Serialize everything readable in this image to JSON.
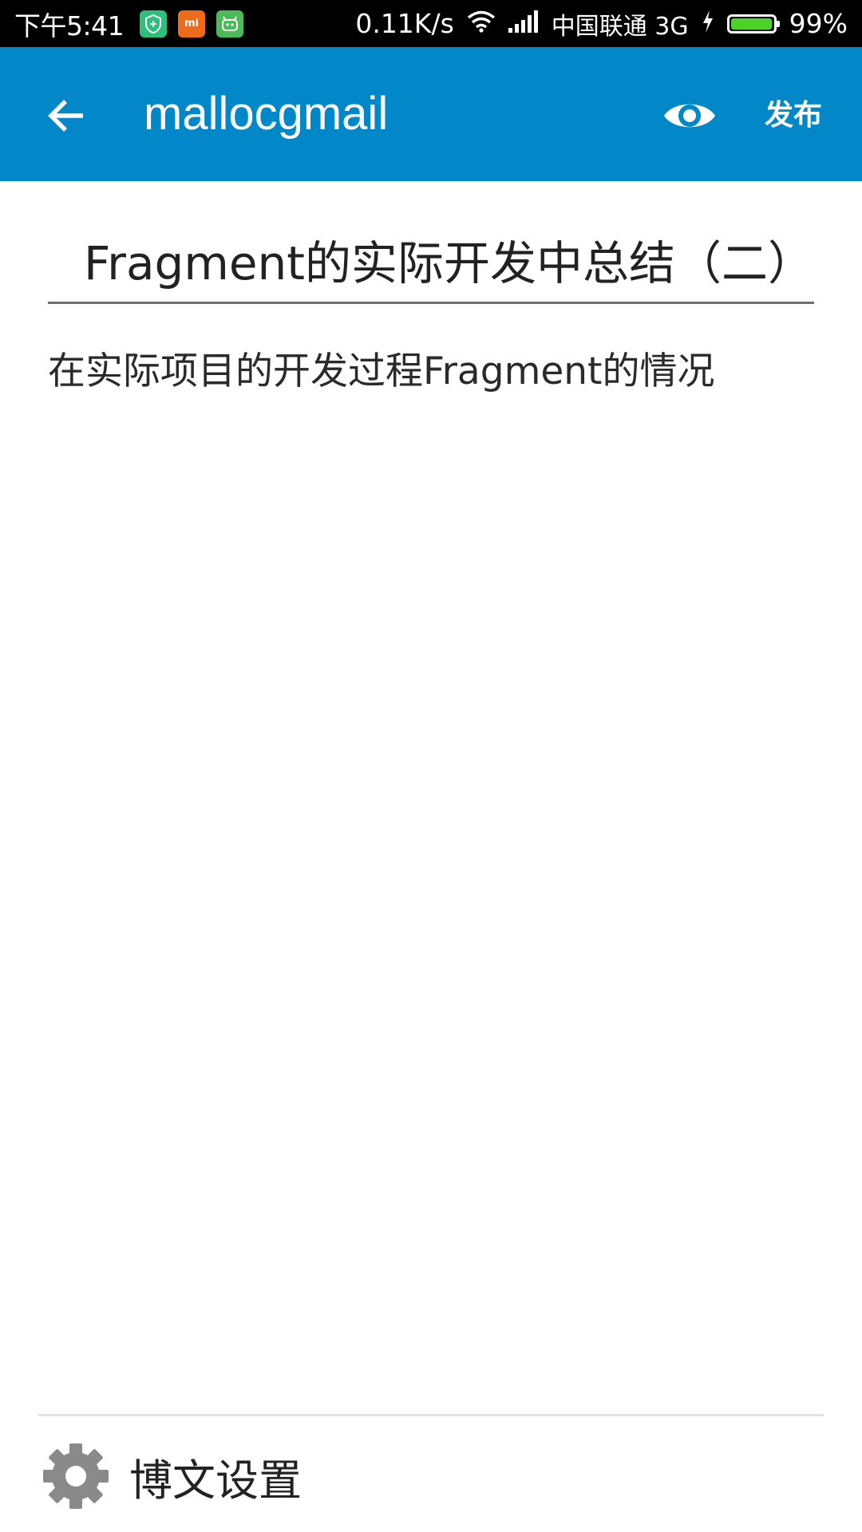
{
  "status_bar": {
    "time": "下午5:41",
    "notif_icons": [
      {
        "name": "shield-app-icon",
        "color": "#2dbf7b"
      },
      {
        "name": "mi-app-icon",
        "color": "#ef6b1c",
        "glyph": "mi"
      },
      {
        "name": "android-app-icon",
        "color": "#4aba5a"
      }
    ],
    "net_speed": "0.11K/s",
    "carrier": "中国联通 3G",
    "battery": "99%",
    "battery_level": 0.99,
    "battery_color": "#4cd327"
  },
  "toolbar": {
    "color": "#0288c8",
    "back_icon": "arrow-back-icon",
    "title": "mallocgmail",
    "preview_icon": "eye-icon",
    "publish_label": "发布"
  },
  "editor": {
    "title_value": "Fragment的实际开发中总结（二）",
    "body_value": "在实际项目的开发过程Fragment的情况"
  },
  "footer": {
    "settings_icon": "gear-icon",
    "settings_label": "博文设置"
  }
}
